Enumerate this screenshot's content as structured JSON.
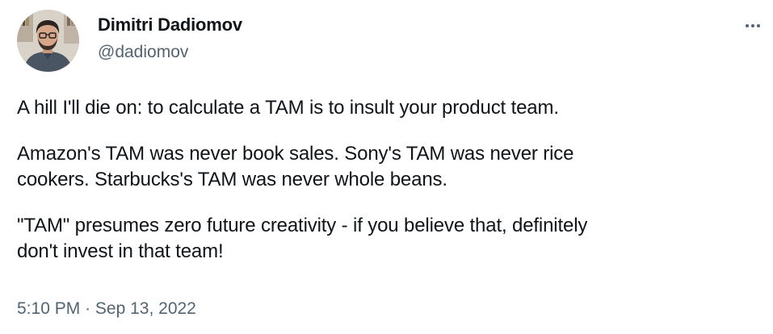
{
  "author": {
    "display_name": "Dimitri Dadiomov",
    "handle": "@dadiomov",
    "avatar_icon": "person-portrait-avatar"
  },
  "tweet": {
    "paragraphs": [
      "A hill I'll die on: to calculate a TAM is to insult your product team.",
      "Amazon's TAM was never book sales. Sony's TAM was never rice\ncookers. Starbucks's TAM was never whole beans.",
      "\"TAM\" presumes zero future creativity - if you believe that, definitely\ndon't invest in that team!"
    ],
    "time": "5:10 PM",
    "separator": "·",
    "date": "Sep 13, 2022"
  },
  "actions": {
    "more_icon": "more-horizontal-icon"
  },
  "colors": {
    "text_primary": "#0f1419",
    "text_secondary": "#536471",
    "background": "#ffffff"
  }
}
